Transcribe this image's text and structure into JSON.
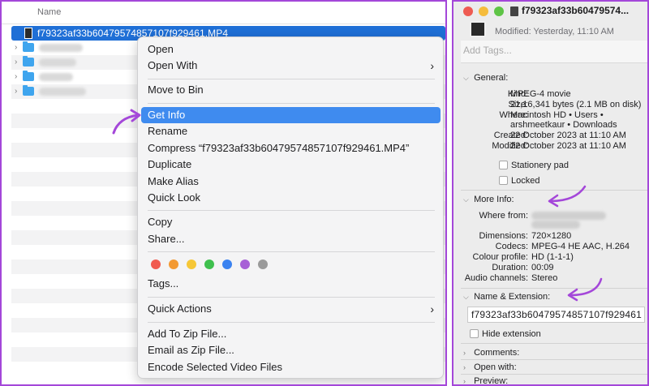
{
  "finder": {
    "column_name": "Name",
    "selected_file": "f79323af33b60479574857107f929461.MP4"
  },
  "context_menu": {
    "items": [
      {
        "label": "Open"
      },
      {
        "label": "Open With"
      },
      {
        "label": "Move to Bin"
      },
      {
        "label": "Get Info"
      },
      {
        "label": "Rename"
      },
      {
        "label": "Compress “f79323af33b60479574857107f929461.MP4”"
      },
      {
        "label": "Duplicate"
      },
      {
        "label": "Make Alias"
      },
      {
        "label": "Quick Look"
      },
      {
        "label": "Copy"
      },
      {
        "label": "Share..."
      },
      {
        "label": "Tags..."
      },
      {
        "label": "Quick Actions"
      },
      {
        "label": "Add To Zip File..."
      },
      {
        "label": "Email as Zip File..."
      },
      {
        "label": "Encode Selected Video Files"
      }
    ],
    "submenu_chevron": "›",
    "highlighted": "Get Info",
    "tag_colors": [
      "#f05a4f",
      "#f39a33",
      "#f6c737",
      "#3fc04e",
      "#3a82f0",
      "#a760d6",
      "#9a9a9a"
    ]
  },
  "info_panel": {
    "title": "f79323af33b60479574...",
    "modified_top": "Modified: Yesterday, 11:10 AM",
    "tags_placeholder": "Add Tags...",
    "sections": {
      "general": "General:",
      "more_info": "More Info:",
      "name_ext": "Name & Extension:",
      "comments": "Comments:",
      "open_with": "Open with:",
      "preview": "Preview:"
    },
    "general": {
      "kind_k": "Kind:",
      "kind_v": "MPEG-4 movie",
      "size_k": "Size:",
      "size_v": "21,16,341 bytes (2.1 MB on disk)",
      "where_k": "Where:",
      "where_v1": "Macintosh HD • Users •",
      "where_v2": "arshmeetkaur • Downloads",
      "created_k": "Created:",
      "created_v": "22 October 2023 at 11:10 AM",
      "modified_k": "Modified:",
      "modified_v": "22 October 2023 at 11:10 AM",
      "stationery": "Stationery pad",
      "locked": "Locked"
    },
    "more_info": {
      "where_from_k": "Where from:",
      "dimensions_k": "Dimensions:",
      "dimensions_v": "720×1280",
      "codecs_k": "Codecs:",
      "codecs_v": "MPEG-4 HE AAC, H.264",
      "colour_k": "Colour profile:",
      "colour_v": "HD (1-1-1)",
      "duration_k": "Duration:",
      "duration_v": "00:09",
      "audio_k": "Audio channels:",
      "audio_v": "Stereo"
    },
    "name_ext": {
      "filename": "f79323af33b60479574857107f929461",
      "hide_extension": "Hide extension"
    }
  },
  "colors": {
    "accent_purple": "#a447d9",
    "selection_blue": "#1f6fd6",
    "menu_highlight": "#3f8bef"
  }
}
